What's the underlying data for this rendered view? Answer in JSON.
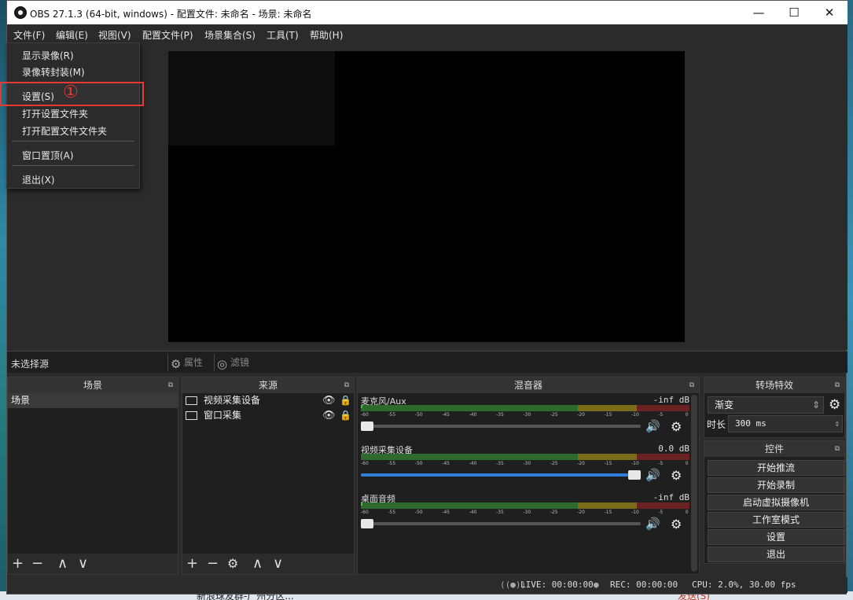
{
  "window": {
    "title": "OBS 27.1.3 (64-bit, windows) - 配置文件: 未命名 - 场景: 未命名",
    "minimize_icon": "—",
    "maximize_icon": "☐",
    "close_icon": "✕"
  },
  "menubar": [
    "文件(F)",
    "编辑(E)",
    "视图(V)",
    "配置文件(P)",
    "场景集合(S)",
    "工具(T)",
    "帮助(H)"
  ],
  "file_menu": {
    "items": [
      "显示录像(R)",
      "录像转封装(M)",
      "设置(S)",
      "打开设置文件夹",
      "打开配置文件文件夹",
      "窗口置顶(A)",
      "退出(X)"
    ],
    "marker": "①",
    "highlight_color": "#e53935"
  },
  "source_toolbar": {
    "status": "未选择源",
    "properties": "属性",
    "filters": "滤镜"
  },
  "scenes": {
    "header": "场景",
    "items": [
      "场景"
    ]
  },
  "sources": {
    "header": "来源",
    "items": [
      "视频采集设备",
      "窗口采集"
    ]
  },
  "mixer": {
    "header": "混音器",
    "ticks": [
      "-60",
      "-55",
      "-50",
      "-45",
      "-40",
      "-35",
      "-30",
      "-25",
      "-20",
      "-15",
      "-10",
      "-5",
      "0"
    ],
    "channels": [
      {
        "name": "麦克风/Aux",
        "db": "-inf dB",
        "volume": 0.0
      },
      {
        "name": "视频采集设备",
        "db": "0.0 dB",
        "volume": 1.0
      },
      {
        "name": "桌面音频",
        "db": "-inf dB",
        "volume": 0.0
      }
    ]
  },
  "transitions": {
    "header": "转场特效",
    "selected": "渐变",
    "duration_label": "时长",
    "duration_value": "300 ms"
  },
  "controls": {
    "header": "控件",
    "buttons": [
      "开始推流",
      "开始录制",
      "启动虚拟摄像机",
      "工作室模式",
      "设置",
      "退出"
    ]
  },
  "status": {
    "live": "LIVE: 00:00:00",
    "rec": "REC: 00:00:00",
    "cpu": "CPU: 2.0%, 30.00 fps"
  },
  "taskbar": {
    "item1": "新浪球友群-广州分区...",
    "item2": "发送(S)"
  }
}
